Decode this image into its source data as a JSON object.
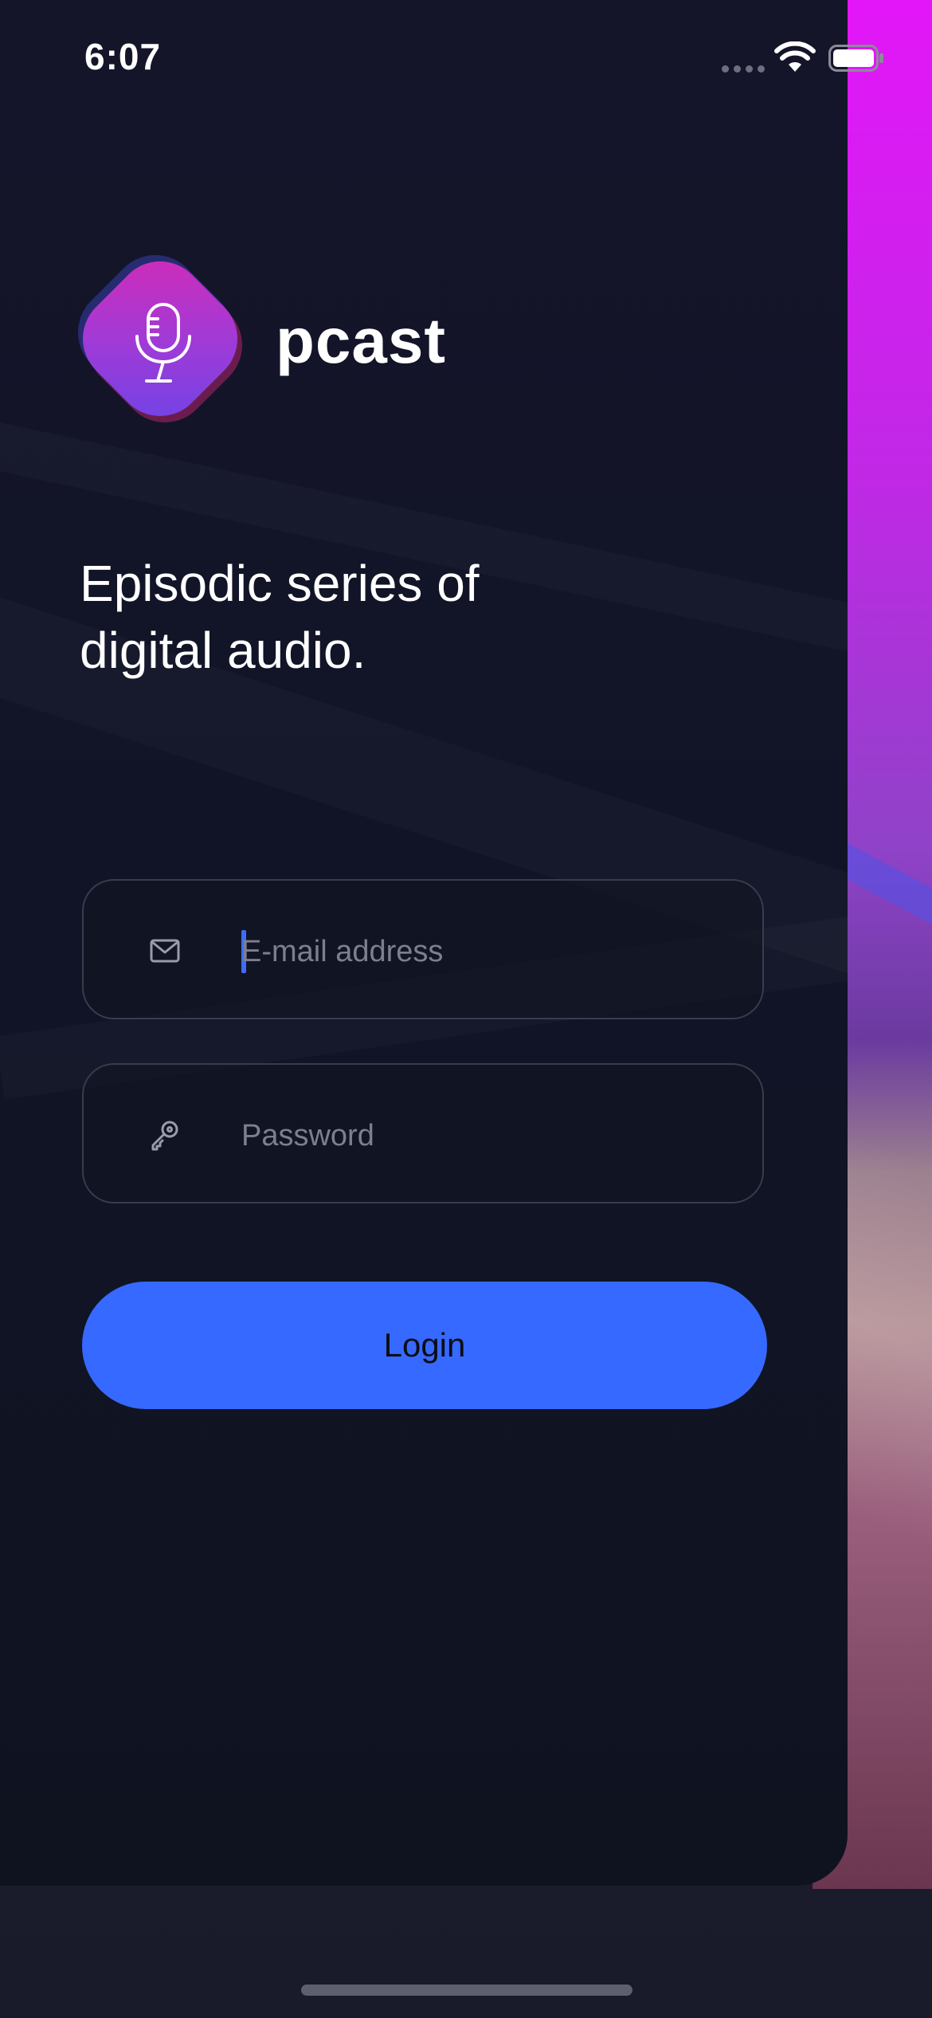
{
  "status_bar": {
    "time": "6:07",
    "icons": [
      "signal-dots-icon",
      "wifi-icon",
      "battery-icon"
    ]
  },
  "app": {
    "name": "pcast",
    "logo_icon": "microphone-icon",
    "tagline": "Episodic series of digital audio."
  },
  "form": {
    "email": {
      "icon": "envelope-icon",
      "placeholder": "E-mail address",
      "value": ""
    },
    "password": {
      "icon": "key-icon",
      "placeholder": "Password",
      "value": ""
    },
    "login_label": "Login"
  },
  "colors": {
    "accent": "#3669ff",
    "logo_gradient_start": "#d52ab4",
    "logo_gradient_end": "#6b44e8",
    "wallpaper": "#e316f8"
  }
}
